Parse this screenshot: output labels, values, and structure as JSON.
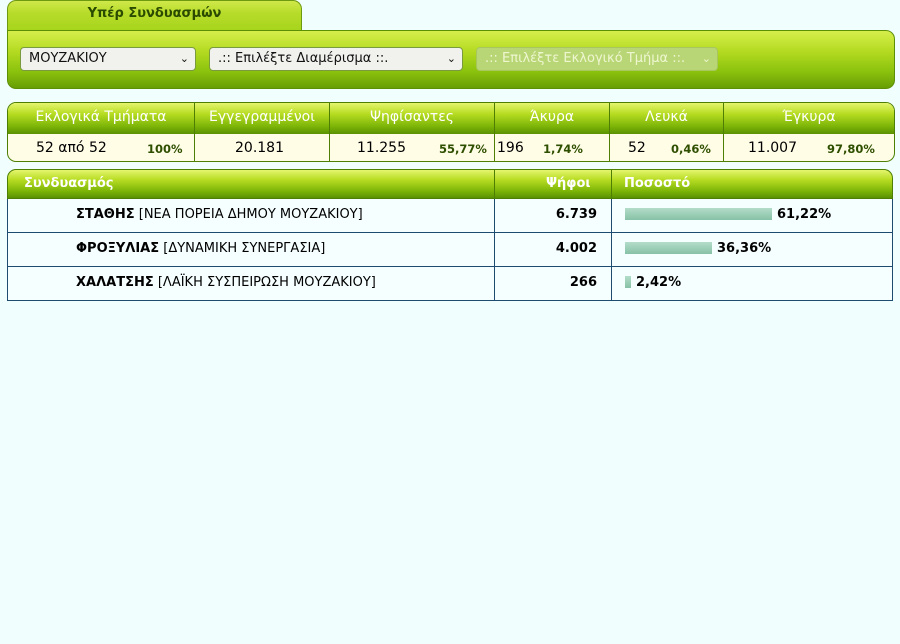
{
  "tab": {
    "label": "Υπέρ Συνδυασμών"
  },
  "filters": {
    "municipality": "ΜΟΥΖΑΚΙΟΥ",
    "district": ".:: Επιλέξτε Διαμέρισμα ::.",
    "station": ".:: Επιλέξτε Εκλογικό Τμήμα ::."
  },
  "stats": {
    "sections": {
      "label": "Εκλογικά Τμήματα",
      "value": "52 από 52",
      "pct": "100%"
    },
    "registered": {
      "label": "Εγγεγραμμένοι",
      "value": "20.181"
    },
    "voted": {
      "label": "Ψηφίσαντες",
      "value": "11.255",
      "pct": "55,77%"
    },
    "invalid": {
      "label": "Άκυρα",
      "value": "196",
      "pct": "1,74%"
    },
    "blank": {
      "label": "Λευκά",
      "value": "52",
      "pct": "0,46%"
    },
    "valid": {
      "label": "Έγκυρα",
      "value": "11.007",
      "pct": "97,80%"
    }
  },
  "results": {
    "headers": {
      "party": "Συνδυασμός",
      "votes": "Ψήφοι",
      "percent": "Ποσοστό"
    },
    "rows": [
      {
        "leader": "ΣΤΑΘΗΣ",
        "party": " [ΝΕΑ ΠΟΡΕΙΑ ΔΗΜΟΥ ΜΟΥΖΑΚΙΟΥ]",
        "votes": "6.739",
        "percent": "61,22%",
        "share": 0.6122
      },
      {
        "leader": "ΦΡΟΞΥΛΙΑΣ",
        "party": " [ΔΥΝΑΜΙΚΗ ΣΥΝΕΡΓΑΣΙΑ]",
        "votes": "4.002",
        "percent": "36,36%",
        "share": 0.3636
      },
      {
        "leader": "ΧΑΛΑΤΣΗΣ",
        "party": " [ΛΑΪΚΗ ΣΥΣΠΕΙΡΩΣΗ ΜΟΥΖΑΚΙΟΥ]",
        "votes": "266",
        "percent": "2,42%",
        "share": 0.0242
      }
    ]
  }
}
